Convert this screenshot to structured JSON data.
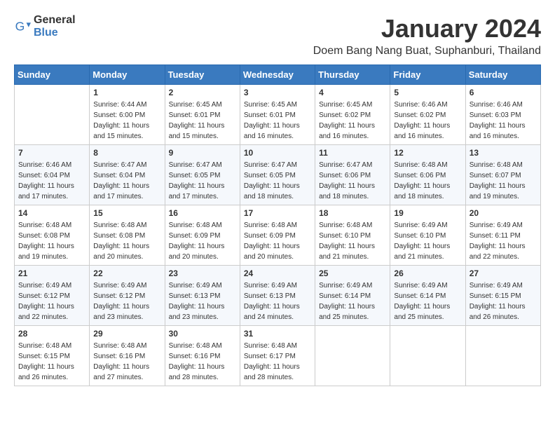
{
  "logo": {
    "general": "General",
    "blue": "Blue"
  },
  "title": "January 2024",
  "subtitle": "Doem Bang Nang Buat, Suphanburi, Thailand",
  "headers": [
    "Sunday",
    "Monday",
    "Tuesday",
    "Wednesday",
    "Thursday",
    "Friday",
    "Saturday"
  ],
  "weeks": [
    [
      {
        "day": "",
        "info": ""
      },
      {
        "day": "1",
        "info": "Sunrise: 6:44 AM\nSunset: 6:00 PM\nDaylight: 11 hours\nand 15 minutes."
      },
      {
        "day": "2",
        "info": "Sunrise: 6:45 AM\nSunset: 6:01 PM\nDaylight: 11 hours\nand 15 minutes."
      },
      {
        "day": "3",
        "info": "Sunrise: 6:45 AM\nSunset: 6:01 PM\nDaylight: 11 hours\nand 16 minutes."
      },
      {
        "day": "4",
        "info": "Sunrise: 6:45 AM\nSunset: 6:02 PM\nDaylight: 11 hours\nand 16 minutes."
      },
      {
        "day": "5",
        "info": "Sunrise: 6:46 AM\nSunset: 6:02 PM\nDaylight: 11 hours\nand 16 minutes."
      },
      {
        "day": "6",
        "info": "Sunrise: 6:46 AM\nSunset: 6:03 PM\nDaylight: 11 hours\nand 16 minutes."
      }
    ],
    [
      {
        "day": "7",
        "info": "Sunrise: 6:46 AM\nSunset: 6:04 PM\nDaylight: 11 hours\nand 17 minutes."
      },
      {
        "day": "8",
        "info": "Sunrise: 6:47 AM\nSunset: 6:04 PM\nDaylight: 11 hours\nand 17 minutes."
      },
      {
        "day": "9",
        "info": "Sunrise: 6:47 AM\nSunset: 6:05 PM\nDaylight: 11 hours\nand 17 minutes."
      },
      {
        "day": "10",
        "info": "Sunrise: 6:47 AM\nSunset: 6:05 PM\nDaylight: 11 hours\nand 18 minutes."
      },
      {
        "day": "11",
        "info": "Sunrise: 6:47 AM\nSunset: 6:06 PM\nDaylight: 11 hours\nand 18 minutes."
      },
      {
        "day": "12",
        "info": "Sunrise: 6:48 AM\nSunset: 6:06 PM\nDaylight: 11 hours\nand 18 minutes."
      },
      {
        "day": "13",
        "info": "Sunrise: 6:48 AM\nSunset: 6:07 PM\nDaylight: 11 hours\nand 19 minutes."
      }
    ],
    [
      {
        "day": "14",
        "info": "Sunrise: 6:48 AM\nSunset: 6:08 PM\nDaylight: 11 hours\nand 19 minutes."
      },
      {
        "day": "15",
        "info": "Sunrise: 6:48 AM\nSunset: 6:08 PM\nDaylight: 11 hours\nand 20 minutes."
      },
      {
        "day": "16",
        "info": "Sunrise: 6:48 AM\nSunset: 6:09 PM\nDaylight: 11 hours\nand 20 minutes."
      },
      {
        "day": "17",
        "info": "Sunrise: 6:48 AM\nSunset: 6:09 PM\nDaylight: 11 hours\nand 20 minutes."
      },
      {
        "day": "18",
        "info": "Sunrise: 6:48 AM\nSunset: 6:10 PM\nDaylight: 11 hours\nand 21 minutes."
      },
      {
        "day": "19",
        "info": "Sunrise: 6:49 AM\nSunset: 6:10 PM\nDaylight: 11 hours\nand 21 minutes."
      },
      {
        "day": "20",
        "info": "Sunrise: 6:49 AM\nSunset: 6:11 PM\nDaylight: 11 hours\nand 22 minutes."
      }
    ],
    [
      {
        "day": "21",
        "info": "Sunrise: 6:49 AM\nSunset: 6:12 PM\nDaylight: 11 hours\nand 22 minutes."
      },
      {
        "day": "22",
        "info": "Sunrise: 6:49 AM\nSunset: 6:12 PM\nDaylight: 11 hours\nand 23 minutes."
      },
      {
        "day": "23",
        "info": "Sunrise: 6:49 AM\nSunset: 6:13 PM\nDaylight: 11 hours\nand 23 minutes."
      },
      {
        "day": "24",
        "info": "Sunrise: 6:49 AM\nSunset: 6:13 PM\nDaylight: 11 hours\nand 24 minutes."
      },
      {
        "day": "25",
        "info": "Sunrise: 6:49 AM\nSunset: 6:14 PM\nDaylight: 11 hours\nand 25 minutes."
      },
      {
        "day": "26",
        "info": "Sunrise: 6:49 AM\nSunset: 6:14 PM\nDaylight: 11 hours\nand 25 minutes."
      },
      {
        "day": "27",
        "info": "Sunrise: 6:49 AM\nSunset: 6:15 PM\nDaylight: 11 hours\nand 26 minutes."
      }
    ],
    [
      {
        "day": "28",
        "info": "Sunrise: 6:48 AM\nSunset: 6:15 PM\nDaylight: 11 hours\nand 26 minutes."
      },
      {
        "day": "29",
        "info": "Sunrise: 6:48 AM\nSunset: 6:16 PM\nDaylight: 11 hours\nand 27 minutes."
      },
      {
        "day": "30",
        "info": "Sunrise: 6:48 AM\nSunset: 6:16 PM\nDaylight: 11 hours\nand 28 minutes."
      },
      {
        "day": "31",
        "info": "Sunrise: 6:48 AM\nSunset: 6:17 PM\nDaylight: 11 hours\nand 28 minutes."
      },
      {
        "day": "",
        "info": ""
      },
      {
        "day": "",
        "info": ""
      },
      {
        "day": "",
        "info": ""
      }
    ]
  ]
}
